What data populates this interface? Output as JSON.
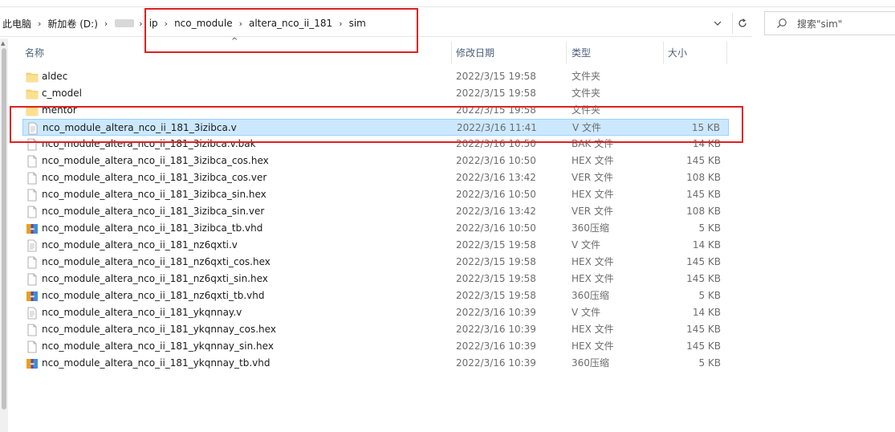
{
  "breadcrumb": {
    "items": [
      "此电脑",
      "新加卷 (D:)",
      "ip",
      "nco_module",
      "altera_nco_ii_181",
      "sim"
    ]
  },
  "search": {
    "placeholder": "搜索\"sim\""
  },
  "columns": {
    "name": "名称",
    "date": "修改日期",
    "type": "类型",
    "size": "大小"
  },
  "files": [
    {
      "name": "aldec",
      "date": "2022/3/15 19:58",
      "type": "文件夹",
      "size": "",
      "icon": "folder-icon"
    },
    {
      "name": "c_model",
      "date": "2022/3/15 19:58",
      "type": "文件夹",
      "size": "",
      "icon": "folder-icon"
    },
    {
      "name": "mentor",
      "date": "2022/3/15 19:58",
      "type": "文件夹",
      "size": "",
      "icon": "folder-icon"
    },
    {
      "name": "nco_module_altera_nco_ii_181_3izibca.v",
      "date": "2022/3/16 11:41",
      "type": "V 文件",
      "size": "15 KB",
      "icon": "text-file-icon",
      "selected": true
    },
    {
      "name": "nco_module_altera_nco_ii_181_3izibca.v.bak",
      "date": "2022/3/16 10:50",
      "type": "BAK 文件",
      "size": "14 KB",
      "icon": "blank-file-icon"
    },
    {
      "name": "nco_module_altera_nco_ii_181_3izibca_cos.hex",
      "date": "2022/3/16 10:50",
      "type": "HEX 文件",
      "size": "145 KB",
      "icon": "blank-file-icon"
    },
    {
      "name": "nco_module_altera_nco_ii_181_3izibca_cos.ver",
      "date": "2022/3/16 13:42",
      "type": "VER 文件",
      "size": "108 KB",
      "icon": "blank-file-icon"
    },
    {
      "name": "nco_module_altera_nco_ii_181_3izibca_sin.hex",
      "date": "2022/3/16 10:50",
      "type": "HEX 文件",
      "size": "145 KB",
      "icon": "blank-file-icon"
    },
    {
      "name": "nco_module_altera_nco_ii_181_3izibca_sin.ver",
      "date": "2022/3/16 13:42",
      "type": "VER 文件",
      "size": "108 KB",
      "icon": "blank-file-icon"
    },
    {
      "name": "nco_module_altera_nco_ii_181_3izibca_tb.vhd",
      "date": "2022/3/16 10:50",
      "type": "360压缩",
      "size": "5 KB",
      "icon": "archive-icon"
    },
    {
      "name": "nco_module_altera_nco_ii_181_nz6qxti.v",
      "date": "2022/3/15 19:58",
      "type": "V 文件",
      "size": "14 KB",
      "icon": "text-file-icon"
    },
    {
      "name": "nco_module_altera_nco_ii_181_nz6qxti_cos.hex",
      "date": "2022/3/15 19:58",
      "type": "HEX 文件",
      "size": "145 KB",
      "icon": "blank-file-icon"
    },
    {
      "name": "nco_module_altera_nco_ii_181_nz6qxti_sin.hex",
      "date": "2022/3/15 19:58",
      "type": "HEX 文件",
      "size": "145 KB",
      "icon": "blank-file-icon"
    },
    {
      "name": "nco_module_altera_nco_ii_181_nz6qxti_tb.vhd",
      "date": "2022/3/15 19:58",
      "type": "360压缩",
      "size": "5 KB",
      "icon": "archive-icon"
    },
    {
      "name": "nco_module_altera_nco_ii_181_ykqnnay.v",
      "date": "2022/3/16 10:39",
      "type": "V 文件",
      "size": "14 KB",
      "icon": "text-file-icon"
    },
    {
      "name": "nco_module_altera_nco_ii_181_ykqnnay_cos.hex",
      "date": "2022/3/16 10:39",
      "type": "HEX 文件",
      "size": "145 KB",
      "icon": "blank-file-icon"
    },
    {
      "name": "nco_module_altera_nco_ii_181_ykqnnay_sin.hex",
      "date": "2022/3/16 10:39",
      "type": "HEX 文件",
      "size": "145 KB",
      "icon": "blank-file-icon"
    },
    {
      "name": "nco_module_altera_nco_ii_181_ykqnnay_tb.vhd",
      "date": "2022/3/16 10:39",
      "type": "360压缩",
      "size": "5 KB",
      "icon": "archive-icon"
    }
  ],
  "colors": {
    "selection": "#cce8ff",
    "selection_border": "#99d1ff",
    "annotation": "#e02020",
    "folder": "#f8d775"
  }
}
